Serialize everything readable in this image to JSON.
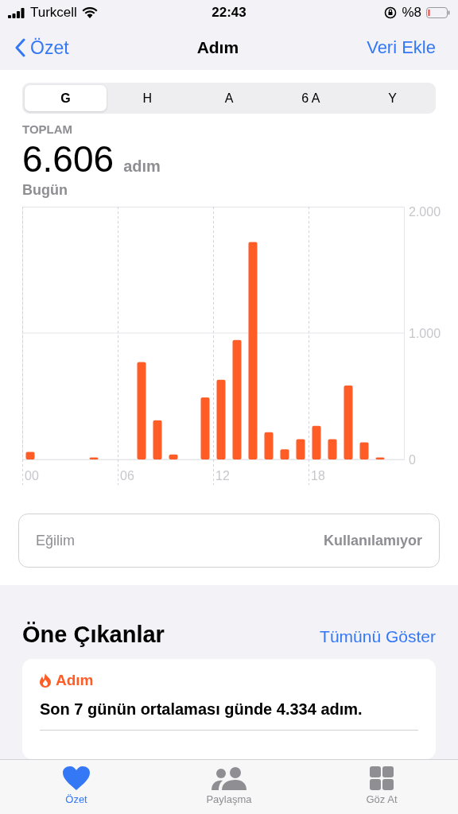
{
  "status_bar": {
    "carrier": "Turkcell",
    "time": "22:43",
    "battery": "%8"
  },
  "nav": {
    "back": "Özet",
    "title": "Adım",
    "action": "Veri Ekle"
  },
  "segments": [
    {
      "label": "G",
      "selected": true
    },
    {
      "label": "H",
      "selected": false
    },
    {
      "label": "A",
      "selected": false
    },
    {
      "label": "6 A",
      "selected": false
    },
    {
      "label": "Y",
      "selected": false
    }
  ],
  "summary": {
    "label": "TOPLAM",
    "value": "6.606",
    "unit": "adım",
    "period": "Bugün"
  },
  "chart_data": {
    "type": "bar",
    "x": [
      0,
      1,
      2,
      3,
      4,
      5,
      6,
      7,
      8,
      9,
      10,
      11,
      12,
      13,
      14,
      15,
      16,
      17,
      18,
      19,
      20,
      21,
      22,
      23
    ],
    "series": [
      {
        "color": "#ff5c26",
        "values": [
          60,
          0,
          0,
          0,
          15,
          0,
          0,
          770,
          310,
          40,
          0,
          490,
          630,
          945,
          1720,
          215,
          80,
          160,
          265,
          160,
          585,
          135,
          15,
          0
        ]
      }
    ],
    "xlim": [
      -0.5,
      23.5
    ],
    "ylim": [
      0,
      2000
    ],
    "xticks": [
      {
        "value": 0,
        "label": "00"
      },
      {
        "value": 6,
        "label": "06"
      },
      {
        "value": 12,
        "label": "12"
      },
      {
        "value": 18,
        "label": "18"
      }
    ],
    "yticks": [
      {
        "value": 0,
        "label": "0"
      },
      {
        "value": 1000,
        "label": "1.000"
      },
      {
        "value": 2000,
        "label": "2.000"
      }
    ]
  },
  "trend": {
    "label": "Eğilim",
    "value": "Kullanılamıyor"
  },
  "highlights": {
    "title": "Öne Çıkanlar",
    "link": "Tümünü Göster",
    "card": {
      "category": "Adım",
      "text": "Son 7 günün ortalaması günde 4.334 adım."
    }
  },
  "tab_bar": [
    {
      "label": "Özet",
      "kind": "heart",
      "selected": true
    },
    {
      "label": "Paylaşma",
      "kind": "people",
      "selected": false
    },
    {
      "label": "Göz At",
      "kind": "grid",
      "selected": false
    }
  ]
}
